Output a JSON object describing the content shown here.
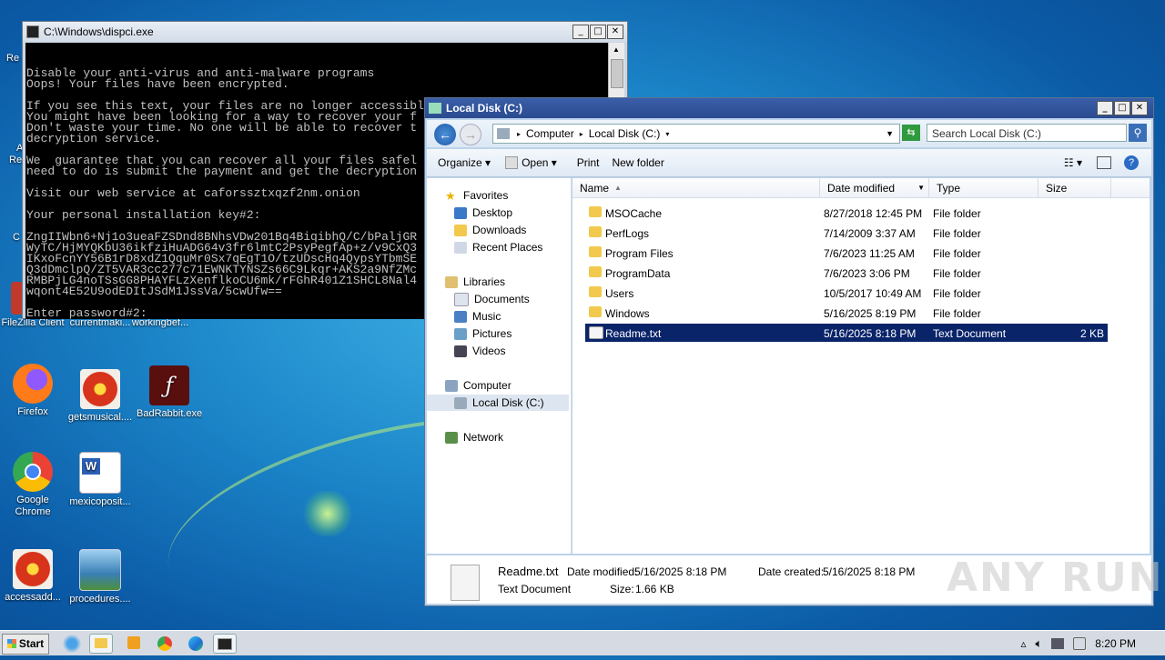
{
  "desktop": {
    "icons": [
      {
        "label": "FileZilla Client",
        "color": "#c0392b"
      },
      {
        "label": "currentmaki...",
        "color": "#d0d0d0"
      },
      {
        "label": "workingbef...",
        "color": "#d0d0d0"
      },
      {
        "label": "Firefox",
        "color": "#ff7b1a"
      },
      {
        "label": "getsmusical....",
        "color": "#e8a020"
      },
      {
        "label": "BadRabbit.exe",
        "color": "#7a1a1a"
      },
      {
        "label": "Google Chrome",
        "color": "#34a853"
      },
      {
        "label": "mexicoposit...",
        "color": "#2b5fb4"
      },
      {
        "label": "accessadd...",
        "color": "#e8a020"
      },
      {
        "label": "procedures....",
        "color": "#6aa0c8"
      }
    ],
    "edge_labels": [
      "Re",
      "A",
      "Re",
      "C"
    ]
  },
  "console": {
    "title": "C:\\Windows\\dispci.exe",
    "lines": [
      "Disable your anti-virus and anti-malware programs",
      "Oops! Your files have been encrypted.",
      "",
      "If you see this text, your files are no longer accessible.",
      "You might have been looking for a way to recover your f",
      "Don't waste your time. No one will be able to recover t",
      "decryption service.",
      "",
      "We  guarantee that you can recover all your files safel",
      "need to do is submit the payment and get the decryption",
      "",
      "Visit our web service at caforssztxqzf2nm.onion",
      "",
      "Your personal installation key#2:",
      "",
      "ZngIIWbn6+Nj1o3ueaFZSDnd8BNhsVDw201Bq4BiqibhQ/C/bPaljGR",
      "WyTC/HjMYQKbU36ikfziHuADG64v3fr6lmtC2PsyPegfAp+z/v9CxQ3",
      "IKxoFcnYY56B1rD8xdZ1QquMr0Sx7qEgT1O/tzUDscHq4QypsYTbmSE",
      "Q3dDmclpQ/ZT5VAR3cc277c71EWNKTYNSZs66C9Lkqr+AKS2a9NfZMc",
      "RMBPjLG4noTSsGG8PHAYFLzXenflkoCU6mk/rFGhR401Z1SHCL8Nal4",
      "wqont4E52U9odEDItJSdM1JssVa/5cwUfw==",
      "",
      "Enter password#2:"
    ]
  },
  "explorer": {
    "title": "Local Disk (C:)",
    "breadcrumb": [
      "Computer",
      "Local Disk (C:)"
    ],
    "search_placeholder": "Search Local Disk (C:)",
    "toolbar": {
      "organize": "Organize",
      "open": "Open",
      "print": "Print",
      "new_folder": "New folder"
    },
    "nav": {
      "favorites": "Favorites",
      "desktop": "Desktop",
      "downloads": "Downloads",
      "recent": "Recent Places",
      "libraries": "Libraries",
      "documents": "Documents",
      "music": "Music",
      "pictures": "Pictures",
      "videos": "Videos",
      "computer": "Computer",
      "local_disk": "Local Disk (C:)",
      "network": "Network"
    },
    "columns": {
      "name": "Name",
      "date": "Date modified",
      "type": "Type",
      "size": "Size"
    },
    "files": [
      {
        "name": "MSOCache",
        "date": "8/27/2018 12:45 PM",
        "type": "File folder",
        "size": ""
      },
      {
        "name": "PerfLogs",
        "date": "7/14/2009 3:37 AM",
        "type": "File folder",
        "size": ""
      },
      {
        "name": "Program Files",
        "date": "7/6/2023 11:25 AM",
        "type": "File folder",
        "size": ""
      },
      {
        "name": "ProgramData",
        "date": "7/6/2023 3:06 PM",
        "type": "File folder",
        "size": ""
      },
      {
        "name": "Users",
        "date": "10/5/2017 10:49 AM",
        "type": "File folder",
        "size": ""
      },
      {
        "name": "Windows",
        "date": "5/16/2025 8:19 PM",
        "type": "File folder",
        "size": ""
      },
      {
        "name": "Readme.txt",
        "date": "5/16/2025 8:18 PM",
        "type": "Text Document",
        "size": "2 KB"
      }
    ],
    "details": {
      "filename": "Readme.txt",
      "date_modified_label": "Date modified:",
      "date_modified": "5/16/2025 8:18 PM",
      "date_created_label": "Date created:",
      "date_created": "5/16/2025 8:18 PM",
      "type": "Text Document",
      "size_label": "Size:",
      "size": "1.66 KB"
    }
  },
  "watermark": "ANY RUN",
  "taskbar": {
    "start": "Start",
    "clock": "8:20 PM"
  },
  "colors": {
    "selection": "#0a246a",
    "folder": "#f2c94c",
    "title_active": "#2a4b8f"
  }
}
